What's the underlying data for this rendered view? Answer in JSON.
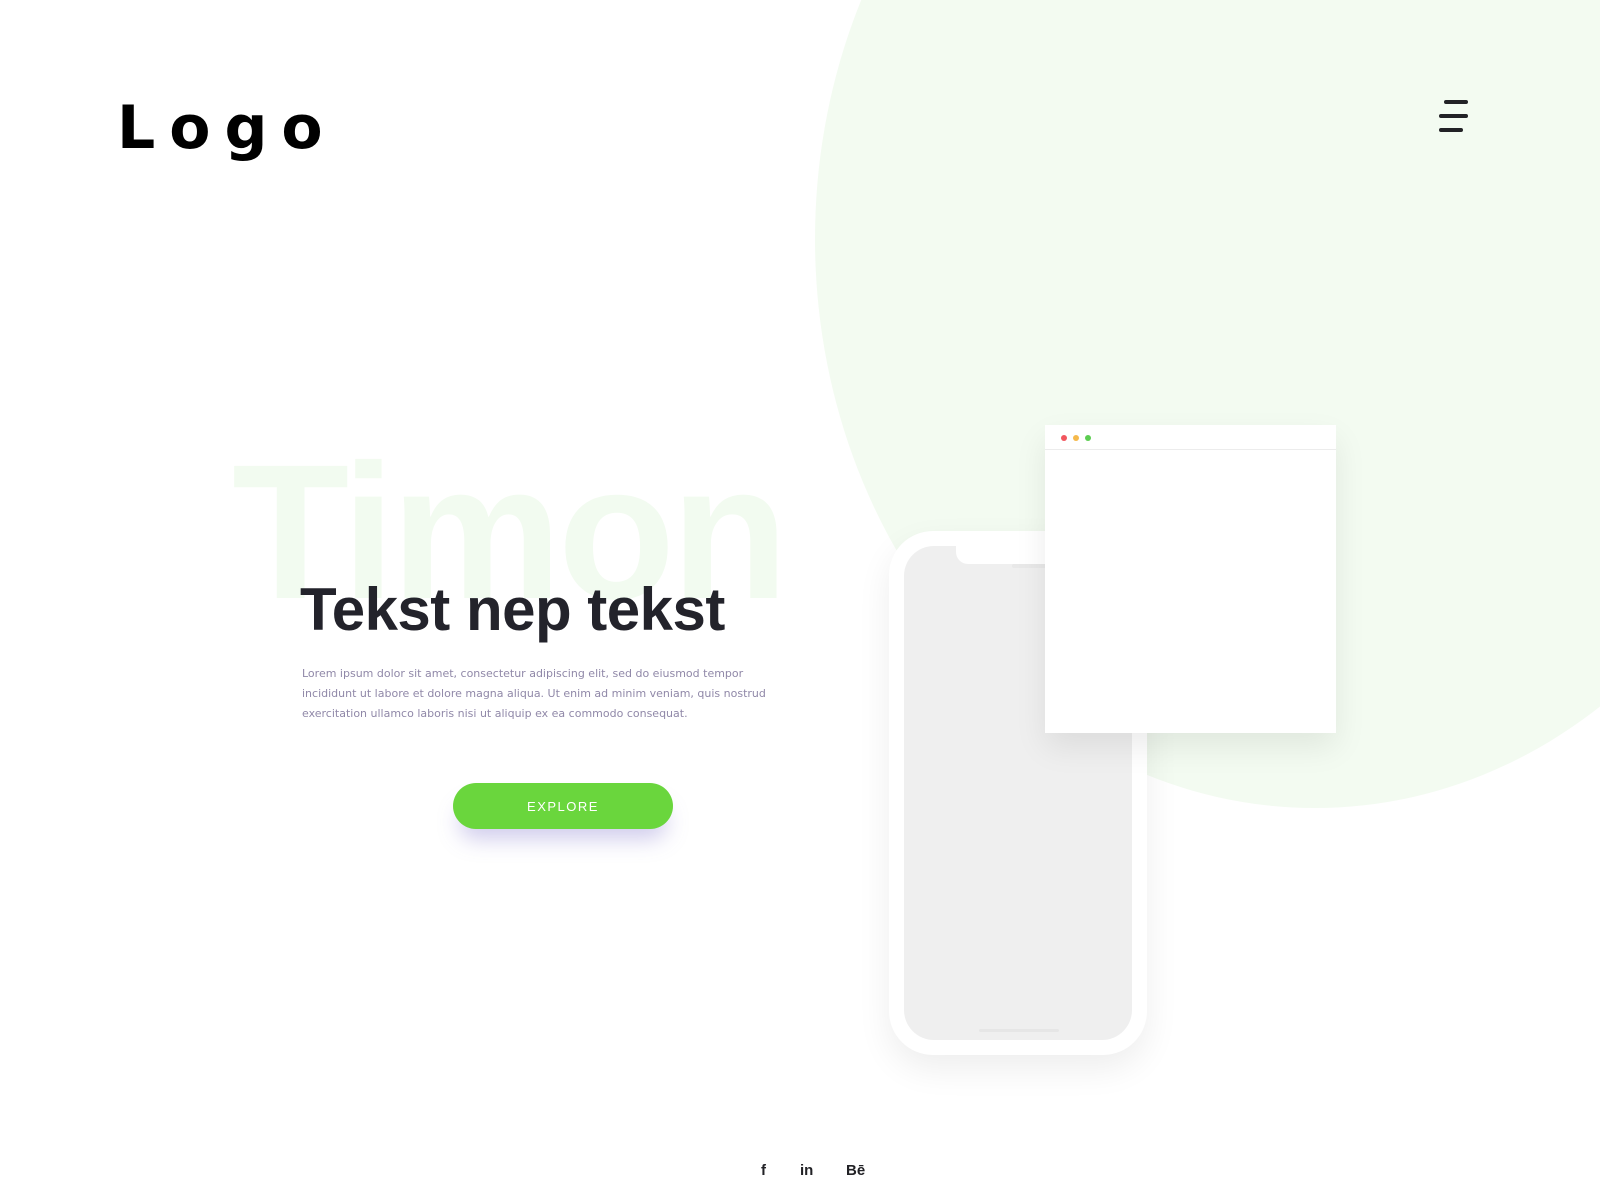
{
  "header": {
    "logo_text": "Logo",
    "menu_icon": "hamburger-menu-icon"
  },
  "hero": {
    "watermark_text": "Timon",
    "headline": "Tekst nep tekst",
    "body": "Lorem ipsum dolor sit amet, consectetur adipiscing elit, sed do eiusmod tempor incididunt ut labore et dolore magna aliqua. Ut enim ad minim veniam, quis nostrud exercitation ullamco laboris nisi ut aliquip ex ea commodo consequat.",
    "cta_label": "EXPLORE"
  },
  "mockups": {
    "phone": "phone-mockup",
    "browser": "browser-window-mockup",
    "browser_dots": [
      "red",
      "yellow",
      "green"
    ]
  },
  "social": {
    "facebook_label": "f",
    "linkedin_label": "in",
    "behance_label": "Bē"
  },
  "colors": {
    "accent": "#6ad63d",
    "background_circle": "#f3fbf1",
    "headline": "#23232b",
    "body_text": "#9088a8",
    "dot_red": "#f2565e",
    "dot_yellow": "#f5b94b",
    "dot_green": "#5ccd51"
  }
}
